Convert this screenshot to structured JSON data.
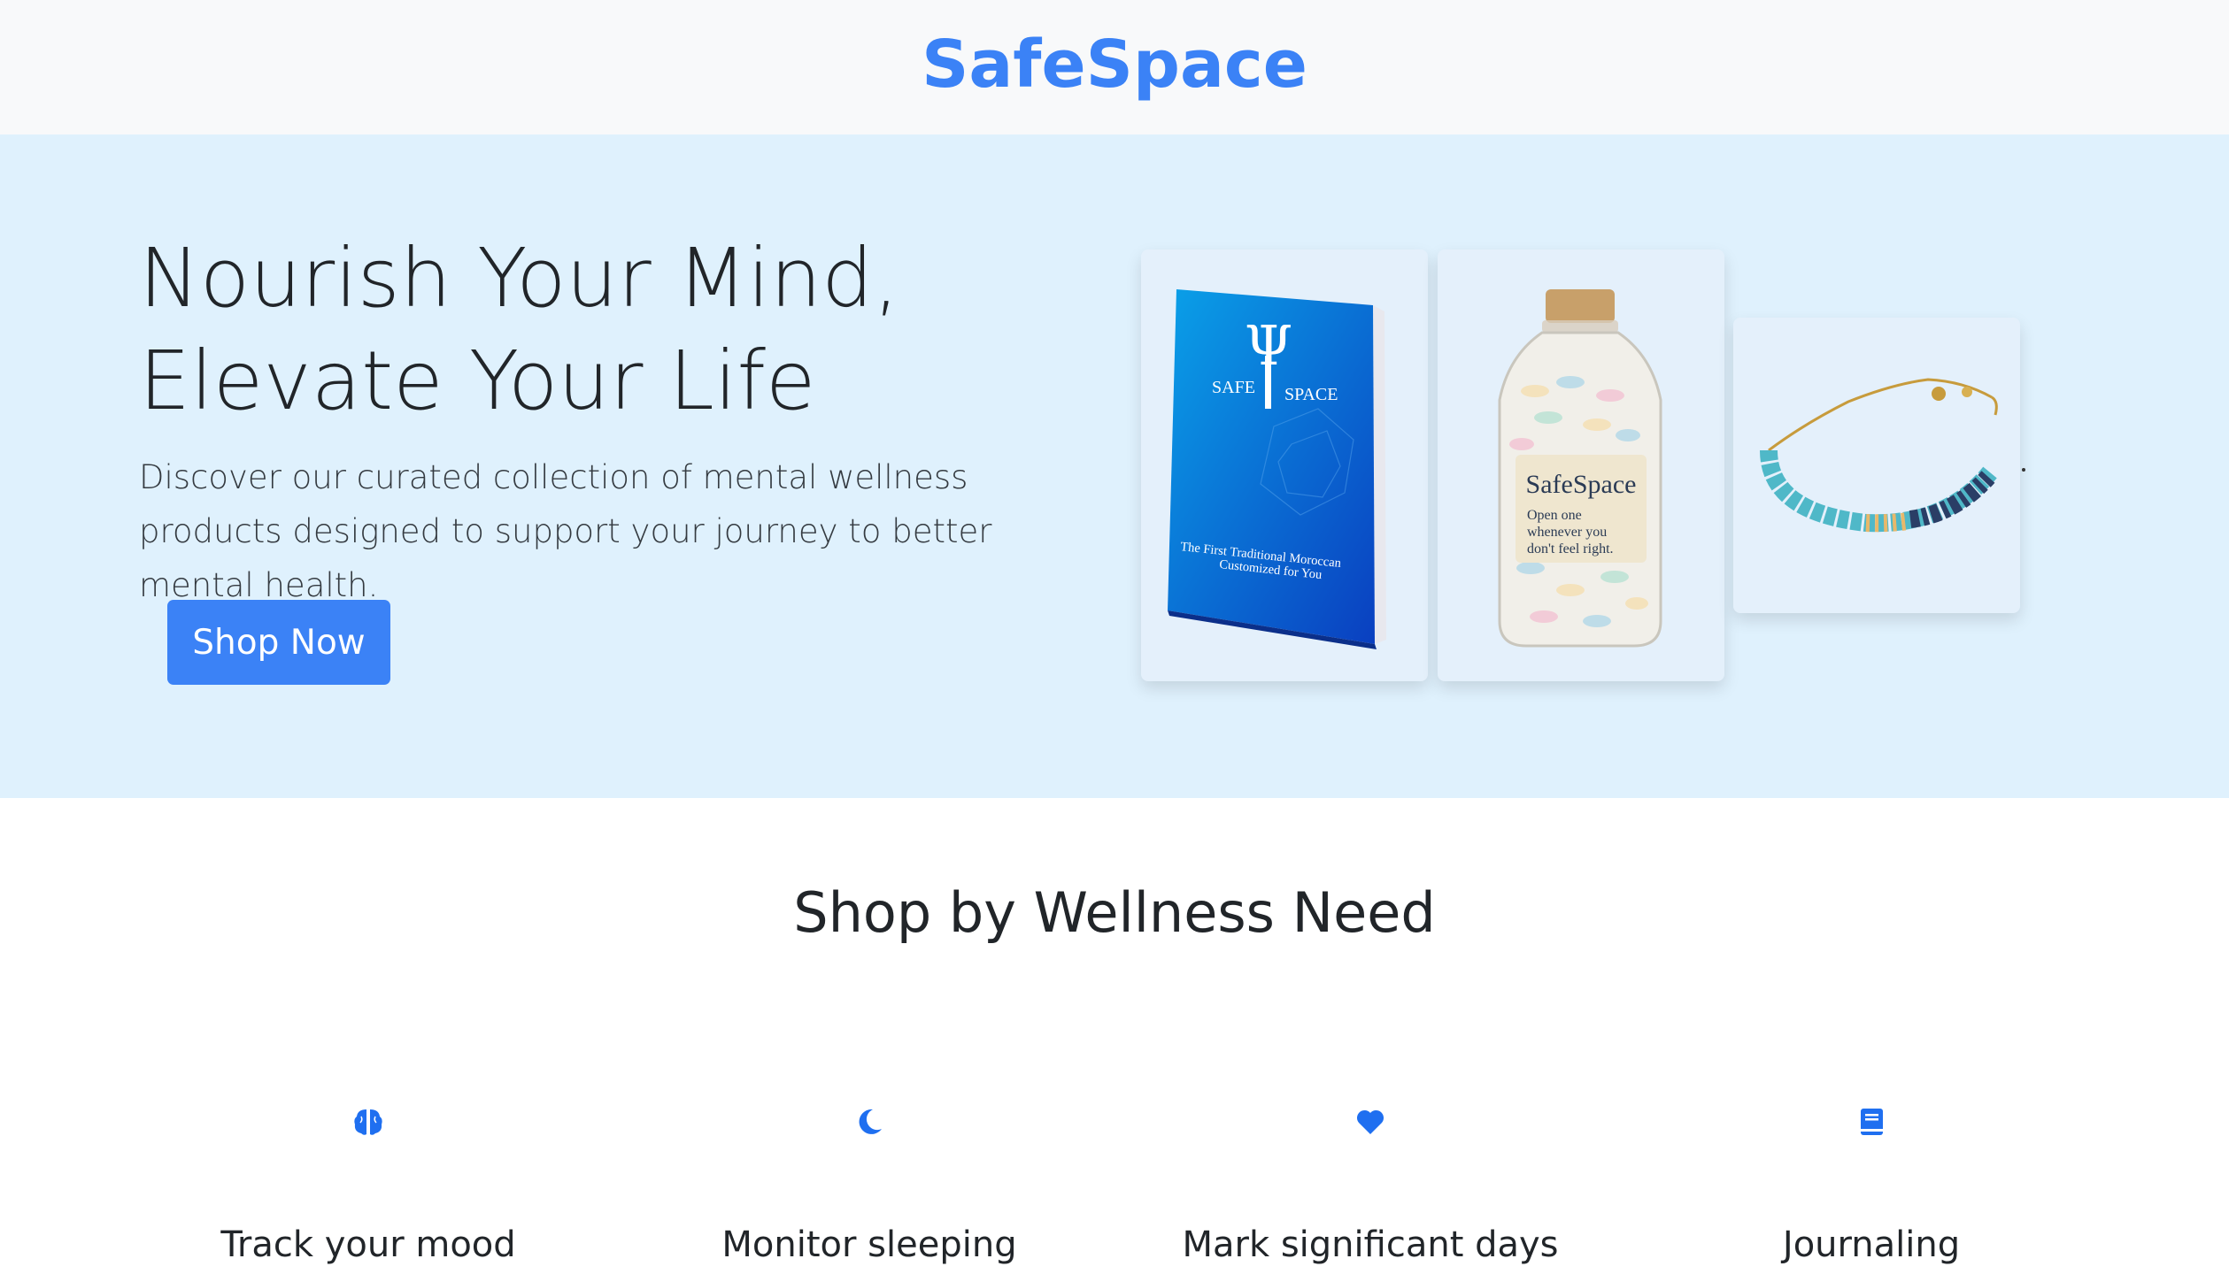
{
  "header": {
    "brand": "SafeSpace"
  },
  "hero": {
    "title_line1": "Nourish Your Mind,",
    "title_line2": "Elevate Your Life",
    "description": "Discover our curated collection of mental wellness products designed to support your journey to better mental health.",
    "cta_label": "Shop Now",
    "products": [
      {
        "name": "book",
        "lines": [
          "SAFE",
          "SPACE",
          "The First Traditional Moroccan",
          "Customized for You"
        ]
      },
      {
        "name": "jar",
        "lines": [
          "SafeSpace",
          "Open one",
          "whenever you",
          "don't feel right."
        ]
      },
      {
        "name": "bracelet"
      }
    ]
  },
  "section": {
    "title": "Shop by Wellness Need",
    "needs": [
      {
        "label": "Track your mood",
        "icon": "brain-icon"
      },
      {
        "label": "Monitor sleeping",
        "icon": "moon-icon"
      },
      {
        "label": "Mark significant days",
        "icon": "heart-icon"
      },
      {
        "label": "Journaling",
        "icon": "journal-icon"
      }
    ]
  },
  "colors": {
    "brand": "#3b82f6",
    "hero_bg": "#dff1fd",
    "icon": "#1f6ff0"
  }
}
